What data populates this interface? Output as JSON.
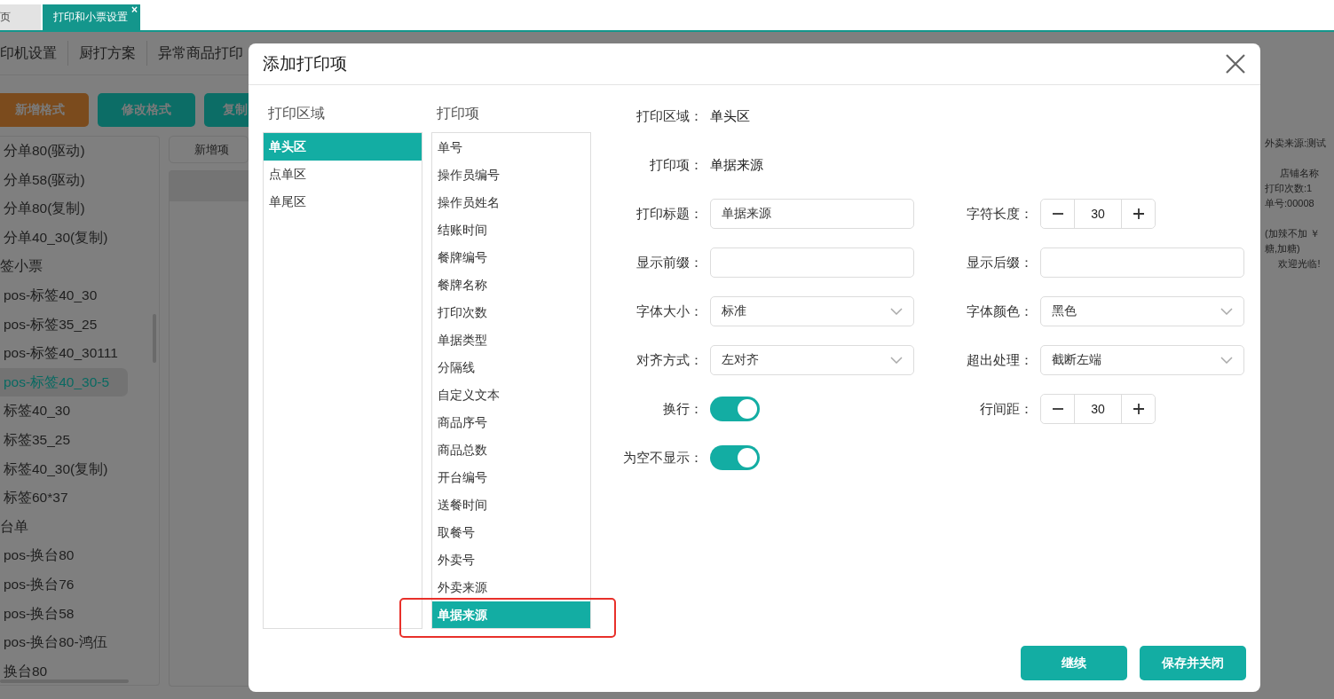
{
  "browser_tabs": [
    {
      "label": "页",
      "selected": false,
      "closable": false
    },
    {
      "label": "打印和小票设置",
      "selected": true,
      "closable": true
    }
  ],
  "close_mark": "×",
  "toolbar_tabs": [
    "印机设置",
    "厨打方案",
    "异常商品打印"
  ],
  "buttons": [
    {
      "label": "新增格式",
      "kind": "warning"
    },
    {
      "label": "修改格式",
      "kind": "primary"
    },
    {
      "label": "复制",
      "kind": "primary"
    }
  ],
  "format_list": [
    {
      "label": "分单80(驱动)",
      "kind": "item",
      "selected": false
    },
    {
      "label": "分单58(驱动)",
      "kind": "item",
      "selected": false
    },
    {
      "label": "分单80(复制)",
      "kind": "item",
      "selected": false
    },
    {
      "label": "分单40_30(复制)",
      "kind": "item",
      "selected": false
    },
    {
      "label": "签小票",
      "kind": "group",
      "selected": false
    },
    {
      "label": "pos-标签40_30",
      "kind": "item",
      "selected": false
    },
    {
      "label": "pos-标签35_25",
      "kind": "item",
      "selected": false
    },
    {
      "label": "pos-标签40_30111",
      "kind": "item",
      "selected": false
    },
    {
      "label": "pos-标签40_30-5",
      "kind": "item",
      "selected": true
    },
    {
      "label": "标签40_30",
      "kind": "item",
      "selected": false
    },
    {
      "label": "标签35_25",
      "kind": "item",
      "selected": false
    },
    {
      "label": "标签40_30(复制)",
      "kind": "item",
      "selected": false
    },
    {
      "label": "标签60*37",
      "kind": "item",
      "selected": false
    },
    {
      "label": "台单",
      "kind": "group",
      "selected": false
    },
    {
      "label": "pos-换台80",
      "kind": "item",
      "selected": false
    },
    {
      "label": "pos-换台76",
      "kind": "item",
      "selected": false
    },
    {
      "label": "pos-换台58",
      "kind": "item",
      "selected": false
    },
    {
      "label": "pos-换台80-鸿伍",
      "kind": "item",
      "selected": false
    },
    {
      "label": "换台80",
      "kind": "item",
      "selected": false
    }
  ],
  "add_item_button": "新增项",
  "preview_blocks": [
    [
      {
        "text": "外卖来源:测试",
        "centered": false
      }
    ],
    [
      {
        "text": "店铺名称",
        "centered": true
      },
      {
        "text": "打印次数:1",
        "centered": false
      },
      {
        "text": "单号:00008",
        "centered": false
      }
    ],
    [
      {
        "text": "(加辣不加 ￥",
        "centered": false
      },
      {
        "text": "糖,加糖)",
        "centered": false
      },
      {
        "text": "欢迎光临!",
        "centered": true
      }
    ]
  ],
  "dialog": {
    "title": "添加打印项",
    "area_heading": "打印区域",
    "areas": [
      {
        "label": "单头区",
        "selected": true
      },
      {
        "label": "点单区",
        "selected": false
      },
      {
        "label": "单尾区",
        "selected": false
      }
    ],
    "item_heading": "打印项",
    "items": [
      {
        "label": "单号",
        "selected": false
      },
      {
        "label": "操作员编号",
        "selected": false
      },
      {
        "label": "操作员姓名",
        "selected": false
      },
      {
        "label": "结账时间",
        "selected": false
      },
      {
        "label": "餐牌编号",
        "selected": false
      },
      {
        "label": "餐牌名称",
        "selected": false
      },
      {
        "label": "打印次数",
        "selected": false
      },
      {
        "label": "单据类型",
        "selected": false
      },
      {
        "label": "分隔线",
        "selected": false
      },
      {
        "label": "自定义文本",
        "selected": false
      },
      {
        "label": "商品序号",
        "selected": false
      },
      {
        "label": "商品总数",
        "selected": false
      },
      {
        "label": "开台编号",
        "selected": false
      },
      {
        "label": "送餐时间",
        "selected": false
      },
      {
        "label": "取餐号",
        "selected": false
      },
      {
        "label": "外卖号",
        "selected": false
      },
      {
        "label": "外卖来源",
        "selected": false
      },
      {
        "label": "单据来源",
        "selected": true
      }
    ],
    "form_rows": [
      [
        {
          "kind": "static",
          "label": "打印区域：",
          "value": "单头区"
        }
      ],
      [
        {
          "kind": "static",
          "label": "打印项：",
          "value": "单据来源"
        }
      ],
      [
        {
          "kind": "input",
          "label": "打印标题：",
          "value": "单据来源"
        },
        {
          "kind": "stepper",
          "label": "字符长度：",
          "value": "30"
        }
      ],
      [
        {
          "kind": "input",
          "label": "显示前缀："
        },
        {
          "kind": "input",
          "label": "显示后缀："
        }
      ],
      [
        {
          "kind": "select",
          "label": "字体大小：",
          "value": "标准"
        },
        {
          "kind": "select",
          "label": "字体颜色：",
          "value": "黑色"
        }
      ],
      [
        {
          "kind": "select",
          "label": "对齐方式：",
          "value": "左对齐"
        },
        {
          "kind": "select",
          "label": "超出处理：",
          "value": "截断左端"
        }
      ],
      [
        {
          "kind": "toggle",
          "label": "换行：",
          "on": true
        },
        {
          "kind": "stepper",
          "label": "行间距：",
          "value": "30"
        }
      ],
      [
        {
          "kind": "toggle",
          "label": "为空不显示：",
          "on": true
        }
      ]
    ],
    "footer_buttons": [
      "继续",
      "保存并关闭"
    ]
  }
}
